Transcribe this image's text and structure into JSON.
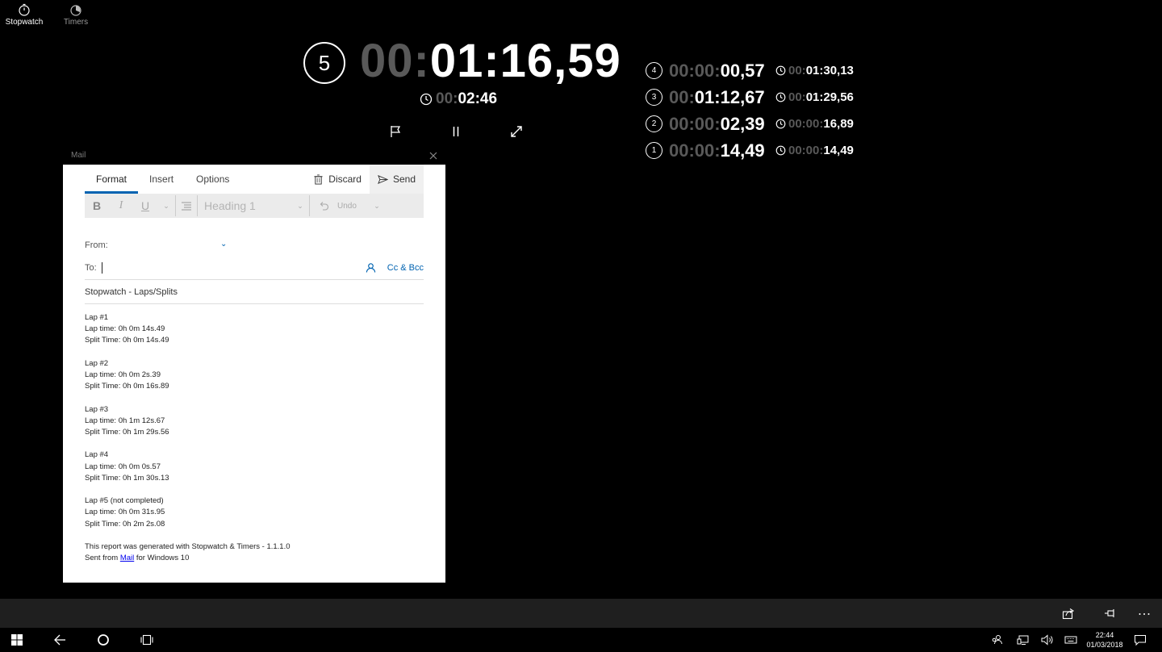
{
  "nav": {
    "stopwatch_label": "Stopwatch",
    "timers_label": "Timers"
  },
  "stopwatch": {
    "current_lap_number": "5",
    "main_time_dim": "00:",
    "main_time_bright": "01:16,59",
    "total_dim": "00:",
    "total_bright": "02:46"
  },
  "laps": [
    {
      "number": "4",
      "time_dim": "00:00:",
      "time_bright": "00,57",
      "split_dim": "00:",
      "split_bright": "01:30,13"
    },
    {
      "number": "3",
      "time_dim": "00:",
      "time_bright": "01:12,67",
      "split_dim": "00:",
      "split_bright": "01:29,56"
    },
    {
      "number": "2",
      "time_dim": "00:00:",
      "time_bright": "02,39",
      "split_dim": "00:00:",
      "split_bright": "16,89"
    },
    {
      "number": "1",
      "time_dim": "00:00:",
      "time_bright": "14,49",
      "split_dim": "00:00:",
      "split_bright": "14,49"
    }
  ],
  "mail": {
    "window_title": "Mail",
    "tabs": [
      "Format",
      "Insert",
      "Options"
    ],
    "discard_label": "Discard",
    "send_label": "Send",
    "toolbar": {
      "bold": "B",
      "italic": "I",
      "underline": "U",
      "style": "Heading 1",
      "undo": "Undo"
    },
    "from_label": "From:",
    "to_label": "To:",
    "cc_bcc_label": "Cc & Bcc",
    "subject": "Stopwatch - Laps/Splits",
    "body": {
      "lap1": [
        "Lap #1",
        "Lap time: 0h 0m 14s.49",
        "Split Time: 0h 0m 14s.49"
      ],
      "lap2": [
        "Lap #2",
        "Lap time: 0h 0m 2s.39",
        "Split Time: 0h 0m 16s.89"
      ],
      "lap3": [
        "Lap #3",
        "Lap time: 0h 1m 12s.67",
        "Split Time: 0h 1m 29s.56"
      ],
      "lap4": [
        "Lap #4",
        "Lap time: 0h 0m 0s.57",
        "Split Time: 0h 1m 30s.13"
      ],
      "lap5": [
        "Lap #5 (not completed)",
        "Lap time: 0h 0m 31s.95",
        "Split Time: 0h 2m 2s.08"
      ],
      "footer_line1": "This report was generated with Stopwatch & Timers - 1.1.1.0",
      "sent_from_prefix": "Sent from ",
      "sent_from_link": "Mail",
      "sent_from_suffix": " for Windows 10"
    }
  },
  "taskbar": {
    "time": "22:44",
    "date": "01/03/2018"
  },
  "colors": {
    "accent": "#0063b1",
    "dim_digits": "#595959"
  }
}
